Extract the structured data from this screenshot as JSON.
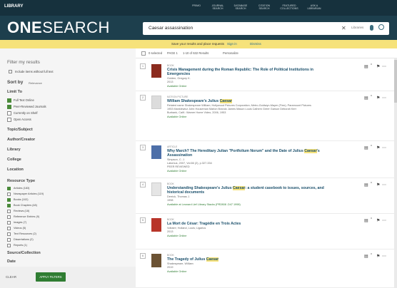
{
  "nav": {
    "logo": "LIBRARY",
    "items": [
      "PRIMO",
      "JOURNAL SEARCH",
      "DATABASE SEARCH",
      "CITATION SEARCH",
      "FEATURED COLLECTIONS",
      "ASK A LIBRARIAN"
    ]
  },
  "search": {
    "brand_bold": "ONE",
    "brand_rest": "SEARCH",
    "query": "Caesar assassination",
    "scope": "Libraries",
    "clear_icon": "close-icon",
    "mic_icon": "microphone-icon",
    "search_icon": "search-icon"
  },
  "banner": {
    "text": "Save your results and place requests",
    "signin": "Sign in",
    "dismiss": "Dismiss"
  },
  "sidebar": {
    "title": "Filter my results",
    "include_no_fulltext": "Include items without full text",
    "sort_label": "Sort by",
    "sort_value": "Relevance",
    "limit_to": "Limit To",
    "limits": [
      {
        "label": "Full Text Online",
        "checked": true
      },
      {
        "label": "Peer-Reviewed Journals",
        "checked": true
      },
      {
        "label": "Currently on Shelf",
        "checked": false
      },
      {
        "label": "Open Access",
        "checked": false
      }
    ],
    "facets": [
      "Topic/Subject",
      "Author/Creator",
      "Library",
      "College",
      "Location"
    ],
    "resource_type": "Resource Type",
    "resources": [
      {
        "label": "Articles (183)",
        "checked": true
      },
      {
        "label": "Newspaper Articles (119)",
        "checked": false
      },
      {
        "label": "Books (102)",
        "checked": true
      },
      {
        "label": "Book Chapters (48)",
        "checked": true
      },
      {
        "label": "Reviews (18)",
        "checked": false
      },
      {
        "label": "Reference Entries (9)",
        "checked": false
      },
      {
        "label": "Images (7)",
        "checked": false
      },
      {
        "label": "Videos (5)",
        "checked": false
      },
      {
        "label": "Text Resources (2)",
        "checked": false
      },
      {
        "label": "Dissertations (2)",
        "checked": false
      },
      {
        "label": "Reports (1)",
        "checked": false
      }
    ],
    "source": "Source/Collection",
    "date": "Date",
    "clear": "CLEAR",
    "apply": "APPLY FILTERS"
  },
  "toolbar": {
    "selected": "0 selected",
    "page": "PAGE 1",
    "results": "1-10 of 632 Results",
    "personalize": "Personalize"
  },
  "results": [
    {
      "num": "1",
      "type": "BOOK",
      "title": "Crisis Management during the Roman Republic: The Role of Political Institutions in Emergencies",
      "lines": [
        "Golden, Gregory K.",
        "2013"
      ],
      "avail": "Available Online"
    },
    {
      "num": "2",
      "type": "MOTION PICTURE",
      "title": "William Shakespeare's Julius Caesar",
      "lines": [
        "Related name Shakespeare William; Hollywood Pictures Corporation; Metro-Goldwyn-Mayer (Firm); Paramount Pictures",
        "1953 Mankiewicz John Houseman Marlon Brando James Mason Louis Calhern Greer Garson Deborah Kerr",
        "Burbank, Calif.: Warner Home Video, 2006, 1953"
      ],
      "avail": "Available Online"
    },
    {
      "num": "3",
      "type": "ARTICLE",
      "title": "Why March? The Hereditary Julian \"Portfolium Norum\" and the Date of Julius Caesar's Assassination",
      "lines": [
        "Simpson, C. J.",
        "Latomus, 2007, Vol.66 (2), p.327-334",
        "PEER REVIEWED"
      ],
      "avail": "Available Online"
    },
    {
      "num": "4",
      "type": "BOOK",
      "title": "Understanding Shakespeare's Julius Caesar: a student casebook to issues, sources, and historical documents",
      "lines": [
        "Derrick, Thomas J.",
        "1998"
      ],
      "avail": "Available at Leonard Lief Library Stacks (PR2808 .D47 1998)"
    },
    {
      "num": "5",
      "type": "BOOK",
      "title": "La Mort de César: Tragédie en Trois Actes",
      "lines": [
        "Voltaire; Holland, Louis; Ligarius",
        "2013"
      ],
      "avail": "Available Online"
    },
    {
      "num": "6",
      "type": "BOOK",
      "title": "The Tragedy of Julius Caesar",
      "lines": [
        "Shakespeare, William",
        "2019"
      ],
      "avail": "Available Online"
    }
  ]
}
